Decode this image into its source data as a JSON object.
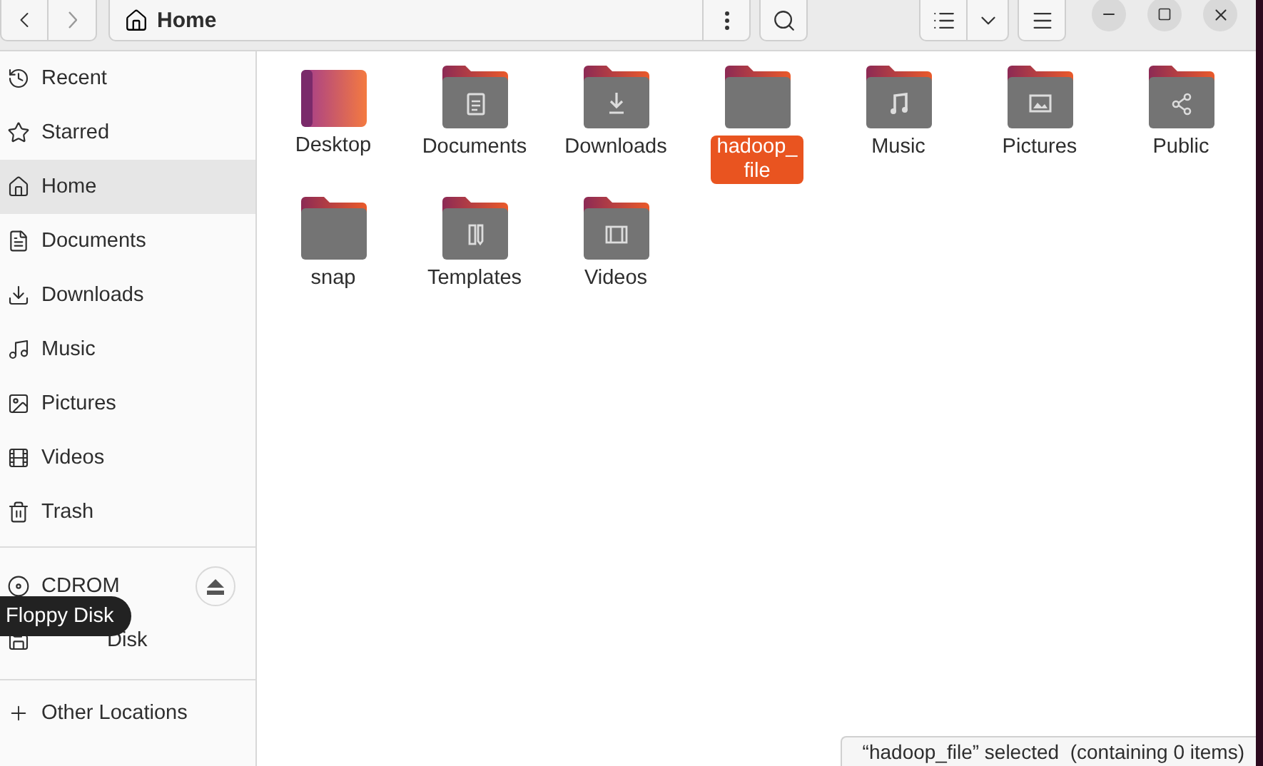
{
  "path_bar": {
    "location": "Home"
  },
  "sidebar": {
    "places": [
      {
        "label": "Recent",
        "kind": "recent",
        "selected": false
      },
      {
        "label": "Starred",
        "kind": "starred",
        "selected": false
      },
      {
        "label": "Home",
        "kind": "home",
        "selected": true
      },
      {
        "label": "Documents",
        "kind": "documents",
        "selected": false
      },
      {
        "label": "Downloads",
        "kind": "downloads",
        "selected": false
      },
      {
        "label": "Music",
        "kind": "music",
        "selected": false
      },
      {
        "label": "Pictures",
        "kind": "pictures",
        "selected": false
      },
      {
        "label": "Videos",
        "kind": "videos",
        "selected": false
      },
      {
        "label": "Trash",
        "kind": "trash",
        "selected": false
      }
    ],
    "devices": [
      {
        "label": "CDROM",
        "kind": "cdrom",
        "eject": true
      },
      {
        "label": "Disk",
        "kind": "floppy",
        "eject": false,
        "covered": true
      }
    ],
    "other": {
      "label": "Other Locations"
    },
    "tooltip": "Floppy Disk"
  },
  "files": [
    {
      "name": "Desktop",
      "kind": "desktop",
      "selected": false
    },
    {
      "name": "Documents",
      "kind": "documents",
      "selected": false
    },
    {
      "name": "Downloads",
      "kind": "downloads",
      "selected": false
    },
    {
      "name": "hadoop_\nfile",
      "kind": "plain",
      "selected": true
    },
    {
      "name": "Music",
      "kind": "music",
      "selected": false
    },
    {
      "name": "Pictures",
      "kind": "pictures",
      "selected": false
    },
    {
      "name": "Public",
      "kind": "public",
      "selected": false
    },
    {
      "name": "snap",
      "kind": "plain",
      "selected": false
    },
    {
      "name": "Templates",
      "kind": "templates",
      "selected": false
    },
    {
      "name": "Videos",
      "kind": "videos",
      "selected": false
    }
  ],
  "status_bar": "“hadoop_file” selected  (containing 0 items)"
}
